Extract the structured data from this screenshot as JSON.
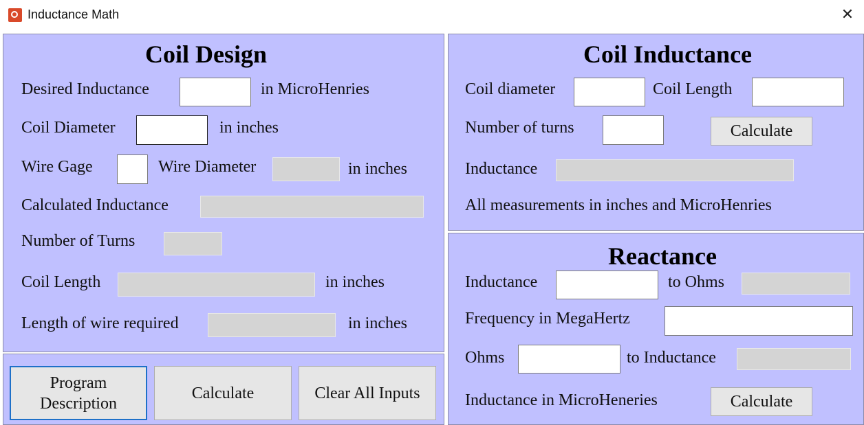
{
  "window": {
    "title": "Inductance Math",
    "close_glyph": "✕"
  },
  "coil_design": {
    "heading": "Coil Design",
    "desired_inductance_label": "Desired Inductance",
    "desired_inductance_unit": "in MicroHenries",
    "desired_inductance_value": "",
    "coil_diameter_label": "Coil Diameter",
    "coil_diameter_unit": "in inches",
    "coil_diameter_value": "",
    "wire_gage_label": "Wire Gage",
    "wire_gage_value": "",
    "wire_diameter_label": "Wire Diameter",
    "wire_diameter_unit": "in inches",
    "wire_diameter_value": "",
    "calculated_inductance_label": "Calculated Inductance",
    "calculated_inductance_value": "",
    "number_of_turns_label": "Number of Turns",
    "number_of_turns_value": "",
    "coil_length_label": "Coil Length",
    "coil_length_unit": "in inches",
    "coil_length_value": "",
    "wire_length_label": "Length of wire required",
    "wire_length_unit": "in inches",
    "wire_length_value": ""
  },
  "buttons": {
    "program_description_line1": "Program",
    "program_description_line2": "Description",
    "calculate": "Calculate",
    "clear_all": "Clear All Inputs"
  },
  "coil_inductance": {
    "heading": "Coil Inductance",
    "coil_diameter_label": "Coil diameter",
    "coil_diameter_value": "",
    "coil_length_label": "Coil Length",
    "coil_length_value": "",
    "number_of_turns_label": "Number of turns",
    "number_of_turns_value": "",
    "calculate": "Calculate",
    "inductance_label": "Inductance",
    "inductance_value": "",
    "note": "All measurements in inches and MicroHenries"
  },
  "reactance": {
    "heading": "Reactance",
    "inductance_label": "Inductance",
    "inductance_value": "",
    "to_ohms_label": "to Ohms",
    "to_ohms_value": "",
    "frequency_label": "Frequency in MegaHertz",
    "frequency_value": "",
    "ohms_label": "Ohms",
    "ohms_value": "",
    "to_inductance_label": "to Inductance",
    "to_inductance_value": "",
    "inductance_microhenries_label": "Inductance in MicroHeneries",
    "calculate": "Calculate"
  },
  "colors": {
    "panel_bg": "#c0c0ff",
    "readonly_bg": "#d4d4d4",
    "button_bg": "#e6e6e6",
    "focus_border": "#1e70c8"
  }
}
